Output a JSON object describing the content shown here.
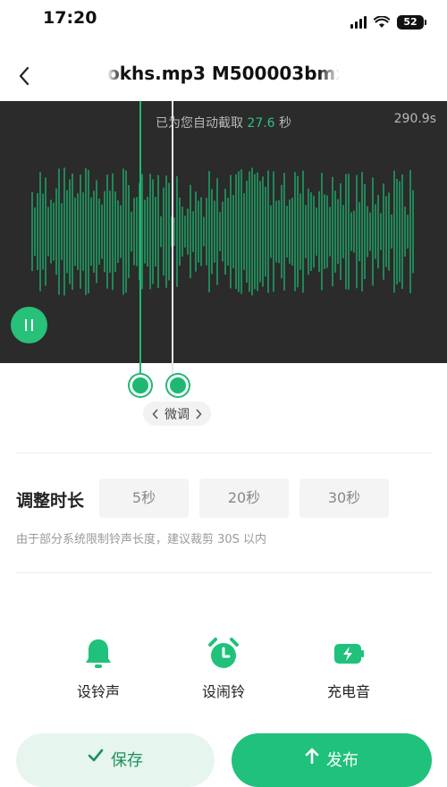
{
  "status_bar": {
    "time": "17:20",
    "battery": "52"
  },
  "nav": {
    "back_icon": "chevron-left-icon",
    "title": "okhs.mp3  M500003bmx"
  },
  "waveform": {
    "hint_prefix": "已为您自动截取 ",
    "hint_seconds": "27.6",
    "hint_suffix": " 秒",
    "total_duration": "290.9s",
    "selection_fraction": [
      0.314,
      0.386
    ],
    "colors": {
      "wave": "#1f9e63",
      "background": "#2b2b2b",
      "accent": "#27c17a"
    }
  },
  "fine_tune": {
    "label": "微调",
    "left_icon": "chevron-left-icon",
    "right_icon": "chevron-right-icon"
  },
  "adjust": {
    "label": "调整时长",
    "options": [
      "5秒",
      "20秒",
      "30秒"
    ],
    "tip": "由于部分系统限制铃声长度，建议裁剪 30S 以内"
  },
  "actions": [
    {
      "label": "设铃声",
      "icon": "bell-icon"
    },
    {
      "label": "设闹铃",
      "icon": "alarm-clock-icon"
    },
    {
      "label": "充电音",
      "icon": "battery-charging-icon"
    }
  ],
  "buttons": {
    "save": "保存",
    "publish": "发布",
    "save_icon": "check-icon",
    "publish_icon": "upload-arrow-icon"
  }
}
